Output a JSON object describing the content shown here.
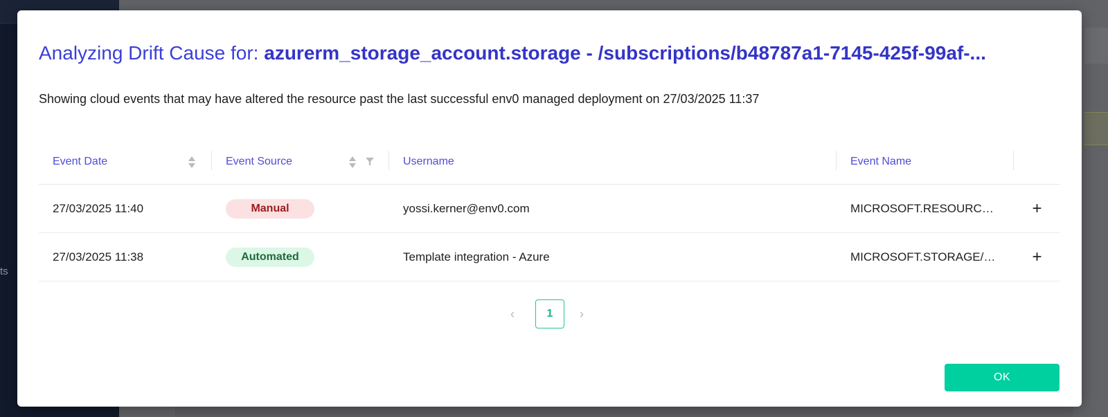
{
  "background": {
    "sidebar_text": "ts"
  },
  "modal": {
    "title_prefix": "Analyzing Drift Cause for: ",
    "title_resource": "azurerm_storage_account.storage - /subscriptions/b48787a1-7145-425f-99af-...",
    "subtitle": "Showing cloud events that may have altered the resource past the last successful env0 managed deployment on 27/03/2025 11:37",
    "table": {
      "columns": {
        "event_date": "Event Date",
        "event_source": "Event Source",
        "username": "Username",
        "event_name": "Event Name"
      },
      "rows": [
        {
          "date": "27/03/2025 11:40",
          "source": "Manual",
          "username": "yossi.kerner@env0.com",
          "event_name": "MICROSOFT.RESOURCE...",
          "expand": "+"
        },
        {
          "date": "27/03/2025 11:38",
          "source": "Automated",
          "username": "Template integration - Azure",
          "event_name": "MICROSOFT.STORAGE/S...",
          "expand": "+"
        }
      ]
    },
    "pagination": {
      "current_page": "1",
      "prev": "‹",
      "next": "›"
    },
    "ok_label": "OK"
  },
  "colors": {
    "accent": "#3b3fd8",
    "primary_button": "#00cfa0",
    "manual_badge_bg": "#fbe1e2",
    "manual_badge_text": "#9c1c1c",
    "automated_badge_bg": "#dcf7e6",
    "automated_badge_text": "#1f6b3a"
  },
  "icons": {
    "sort": "sort-arrows-icon",
    "filter": "filter-icon",
    "expand": "plus-icon"
  }
}
